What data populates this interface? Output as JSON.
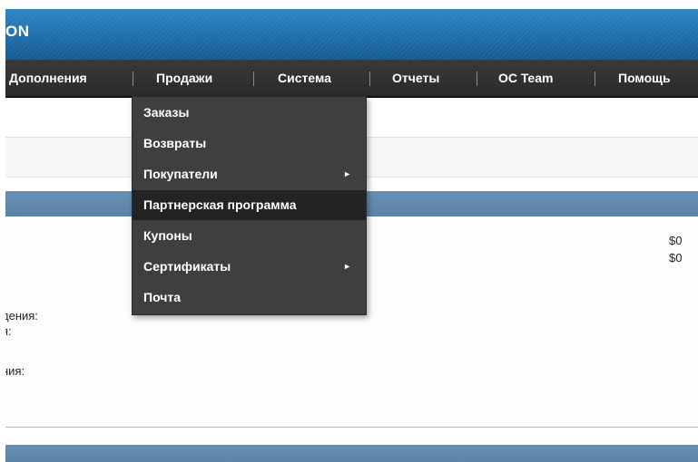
{
  "header": {
    "logo_text": "ON"
  },
  "nav": {
    "items": [
      {
        "label": "Дополнения"
      },
      {
        "label": "Продажи"
      },
      {
        "label": "Система"
      },
      {
        "label": "Отчеты"
      },
      {
        "label": "OC Team"
      },
      {
        "label": "Помощь"
      }
    ]
  },
  "dropdown": {
    "items": [
      {
        "label": "Заказы",
        "has_submenu": false
      },
      {
        "label": "Возвраты",
        "has_submenu": false
      },
      {
        "label": "Покупатели",
        "has_submenu": true,
        "arrow": "►"
      },
      {
        "label": "Партнерская программа",
        "has_submenu": false,
        "highlighted": true
      },
      {
        "label": "Купоны",
        "has_submenu": false
      },
      {
        "label": "Сертификаты",
        "has_submenu": true,
        "arrow": "►"
      },
      {
        "label": "Почта",
        "has_submenu": false
      }
    ]
  },
  "content": {
    "values": [
      "$0",
      "$0"
    ],
    "fragments": [
      "дения:",
      "я:",
      "ния:"
    ]
  },
  "colors": {
    "header_blue": "#1e6ca9",
    "nav_dark": "#2e2e2e",
    "dropdown_bg": "#3f3f3f",
    "dropdown_active": "#232323",
    "section_blue": "#5a83a8"
  }
}
